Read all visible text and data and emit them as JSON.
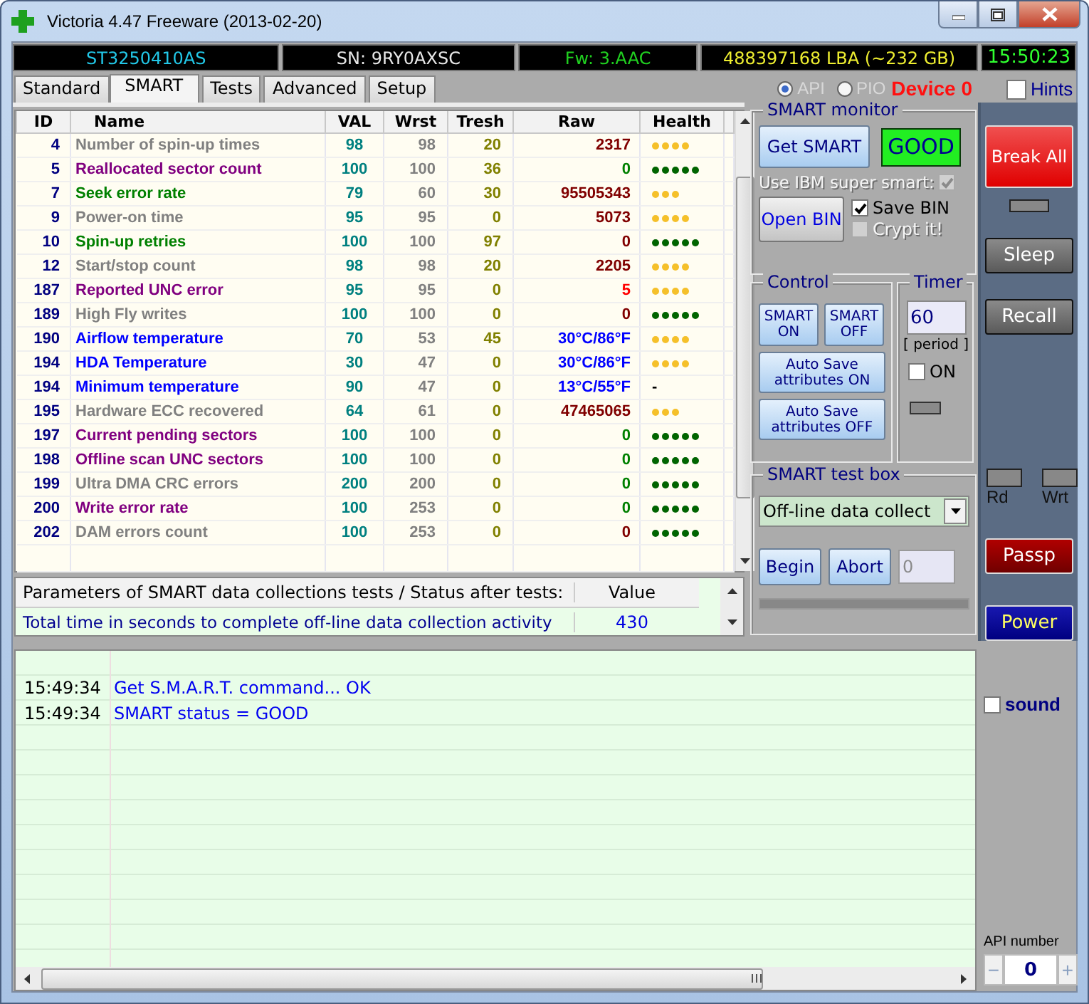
{
  "window": {
    "title": "Victoria 4.47  Freeware (2013-02-20)"
  },
  "info_bar": {
    "model": "ST3250410AS",
    "serial": "SN: 9RY0AXSC",
    "firmware": "Fw: 3.AAC",
    "capacity": "488397168 LBA (~232 GB)",
    "clock": "15:50:23"
  },
  "tabs": [
    {
      "label": "Standard",
      "selected": false
    },
    {
      "label": "SMART",
      "selected": true
    },
    {
      "label": "Tests",
      "selected": false
    },
    {
      "label": "Advanced",
      "selected": false
    },
    {
      "label": "Setup",
      "selected": false
    }
  ],
  "interface": [
    {
      "label": "API",
      "selected": true
    },
    {
      "label": "PIO",
      "selected": false
    }
  ],
  "device": "Device 0",
  "hints": {
    "label": "Hints",
    "checked": false
  },
  "smart_table": {
    "columns": [
      "ID",
      "Name",
      "VAL",
      "Wrst",
      "Tresh",
      "Raw",
      "Health"
    ],
    "rows": [
      {
        "id": "4",
        "name": {
          "text": "Number of spin-up times",
          "color": "#808080"
        },
        "val": "98",
        "worst": "98",
        "thresh": "20",
        "raw": {
          "text": "2317",
          "color": "#800000"
        },
        "health": {
          "kind": "dots",
          "stars": 4,
          "color": "#f5c02a"
        }
      },
      {
        "id": "5",
        "name": {
          "text": "Reallocated sector count",
          "color": "#800080"
        },
        "val": "100",
        "worst": "100",
        "thresh": "36",
        "raw": {
          "text": "0",
          "color": "#008000"
        },
        "health": {
          "kind": "dots",
          "stars": 5,
          "color": "#006400"
        }
      },
      {
        "id": "7",
        "name": {
          "text": "Seek error rate",
          "color": "#008000"
        },
        "val": "79",
        "worst": "60",
        "thresh": "30",
        "raw": {
          "text": "95505343",
          "color": "#800000"
        },
        "health": {
          "kind": "dots",
          "stars": 3,
          "color": "#f5c02a"
        }
      },
      {
        "id": "9",
        "name": {
          "text": "Power-on time",
          "color": "#808080"
        },
        "val": "95",
        "worst": "95",
        "thresh": "0",
        "raw": {
          "text": "5073",
          "color": "#800000"
        },
        "health": {
          "kind": "dots",
          "stars": 4,
          "color": "#f5c02a"
        }
      },
      {
        "id": "10",
        "name": {
          "text": "Spin-up retries",
          "color": "#008000"
        },
        "val": "100",
        "worst": "100",
        "thresh": "97",
        "raw": {
          "text": "0",
          "color": "#800000"
        },
        "health": {
          "kind": "dots",
          "stars": 5,
          "color": "#006400"
        }
      },
      {
        "id": "12",
        "name": {
          "text": "Start/stop count",
          "color": "#808080"
        },
        "val": "98",
        "worst": "98",
        "thresh": "20",
        "raw": {
          "text": "2205",
          "color": "#800000"
        },
        "health": {
          "kind": "dots",
          "stars": 4,
          "color": "#f5c02a"
        }
      },
      {
        "id": "187",
        "name": {
          "text": "Reported UNC error",
          "color": "#800080"
        },
        "val": "95",
        "worst": "95",
        "thresh": "0",
        "raw": {
          "text": "5",
          "color": "#ff0000"
        },
        "health": {
          "kind": "dots",
          "stars": 4,
          "color": "#f5c02a"
        }
      },
      {
        "id": "189",
        "name": {
          "text": "High Fly writes",
          "color": "#808080"
        },
        "val": "100",
        "worst": "100",
        "thresh": "0",
        "raw": {
          "text": "0",
          "color": "#800000"
        },
        "health": {
          "kind": "dots",
          "stars": 5,
          "color": "#006400"
        }
      },
      {
        "id": "190",
        "name": {
          "text": "Airflow temperature",
          "color": "#0000ff"
        },
        "val": "70",
        "worst": "53",
        "thresh": "45",
        "raw": {
          "text": "30°C/86°F",
          "color": "#0000ff"
        },
        "health": {
          "kind": "dots",
          "stars": 4,
          "color": "#f5c02a"
        }
      },
      {
        "id": "194",
        "name": {
          "text": "HDA Temperature",
          "color": "#0000ff"
        },
        "val": "30",
        "worst": "47",
        "thresh": "0",
        "raw": {
          "text": "30°C/86°F",
          "color": "#0000ff"
        },
        "health": {
          "kind": "dots",
          "stars": 4,
          "color": "#f5c02a"
        }
      },
      {
        "id": "194",
        "name": {
          "text": "Minimum temperature",
          "color": "#0000ff"
        },
        "val": "90",
        "worst": "47",
        "thresh": "0",
        "raw": {
          "text": "13°C/55°F",
          "color": "#0000ff"
        },
        "health": {
          "kind": "text",
          "text": "-"
        }
      },
      {
        "id": "195",
        "name": {
          "text": "Hardware ECC recovered",
          "color": "#808080"
        },
        "val": "64",
        "worst": "61",
        "thresh": "0",
        "raw": {
          "text": "47465065",
          "color": "#800000"
        },
        "health": {
          "kind": "dots",
          "stars": 3,
          "color": "#f5c02a"
        }
      },
      {
        "id": "197",
        "name": {
          "text": "Current pending sectors",
          "color": "#800080"
        },
        "val": "100",
        "worst": "100",
        "thresh": "0",
        "raw": {
          "text": "0",
          "color": "#008000"
        },
        "health": {
          "kind": "dots",
          "stars": 5,
          "color": "#006400"
        }
      },
      {
        "id": "198",
        "name": {
          "text": "Offline scan UNC sectors",
          "color": "#800080"
        },
        "val": "100",
        "worst": "100",
        "thresh": "0",
        "raw": {
          "text": "0",
          "color": "#008000"
        },
        "health": {
          "kind": "dots",
          "stars": 5,
          "color": "#006400"
        }
      },
      {
        "id": "199",
        "name": {
          "text": "Ultra DMA CRC errors",
          "color": "#808080"
        },
        "val": "200",
        "worst": "200",
        "thresh": "0",
        "raw": {
          "text": "0",
          "color": "#008000"
        },
        "health": {
          "kind": "dots",
          "stars": 5,
          "color": "#006400"
        }
      },
      {
        "id": "200",
        "name": {
          "text": "Write error rate",
          "color": "#800080"
        },
        "val": "100",
        "worst": "253",
        "thresh": "0",
        "raw": {
          "text": "0",
          "color": "#008000"
        },
        "health": {
          "kind": "dots",
          "stars": 5,
          "color": "#006400"
        }
      },
      {
        "id": "202",
        "name": {
          "text": "DAM errors count",
          "color": "#808080"
        },
        "val": "100",
        "worst": "253",
        "thresh": "0",
        "raw": {
          "text": "0",
          "color": "#800000"
        },
        "health": {
          "kind": "dots",
          "stars": 5,
          "color": "#006400"
        }
      }
    ]
  },
  "test_params": {
    "columns": [
      "Parameters of SMART data collections tests / Status after tests:",
      "Value"
    ],
    "rows": [
      {
        "parameter": "Total time in seconds to complete off-line data collection activity",
        "value": "430"
      }
    ]
  },
  "smart_monitor": {
    "title": "SMART monitor",
    "get_button": "Get SMART",
    "status": "GOOD",
    "ibm_super_smart": {
      "label": "Use IBM super smart:",
      "checked": true,
      "disabled": true
    },
    "open_button": "Open BIN",
    "save_bin": {
      "label": "Save BIN",
      "checked": true,
      "disabled": false
    },
    "crypt": {
      "label": "Crypt it!",
      "checked": false,
      "disabled": true
    }
  },
  "control": {
    "title": "Control",
    "buttons": [
      {
        "label": "SMART ON",
        "kind": "small"
      },
      {
        "label": "SMART OFF",
        "kind": "small"
      },
      {
        "label": "Auto Save attributes ON",
        "kind": "wide"
      },
      {
        "label": "Auto Save attributes OFF",
        "kind": "wide"
      }
    ]
  },
  "timer": {
    "title": "Timer",
    "value": "60",
    "caption": "[ period ]",
    "on": {
      "label": "ON",
      "checked": false
    }
  },
  "test_box": {
    "title": "SMART test box",
    "selection": "Off-line data collect",
    "begin": "Begin",
    "abort": "Abort",
    "placeholder": "0",
    "progress": {
      "level": 0
    }
  },
  "side_buttons": [
    {
      "label": "Break All",
      "kind": "danger"
    },
    {
      "label": "Sleep",
      "kind": "normal"
    },
    {
      "label": "Recall",
      "kind": "normal"
    },
    {
      "label": "Passp",
      "kind": "warning"
    },
    {
      "label": "Power",
      "kind": "power"
    }
  ],
  "indicators": [
    {
      "label": "Rd"
    },
    {
      "label": "Wrt"
    }
  ],
  "sound": {
    "label": "sound",
    "checked": false
  },
  "api_number": {
    "label": "API number",
    "decrement": "−",
    "value": "0",
    "increment": "+"
  },
  "log": [
    {
      "time": "15:49:34",
      "message": "Get S.M.A.R.T. command... OK"
    },
    {
      "time": "15:49:34",
      "message": "SMART status = GOOD"
    }
  ]
}
